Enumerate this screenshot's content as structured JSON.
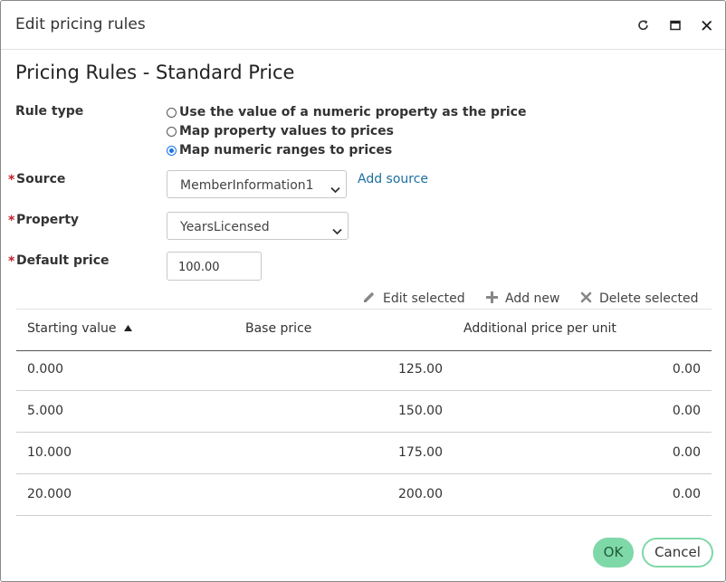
{
  "dialog": {
    "title": "Edit pricing rules",
    "heading": "Pricing Rules - Standard Price",
    "controls": {
      "refresh_icon": "refresh-icon",
      "maximize_icon": "maximize-icon",
      "close_icon": "close-icon"
    }
  },
  "form": {
    "required_marker": "*",
    "rule_type": {
      "label": "Rule type",
      "options": [
        {
          "label": "Use the value of a numeric property as the price",
          "checked": false
        },
        {
          "label": "Map property values to prices",
          "checked": false
        },
        {
          "label": "Map numeric ranges to prices",
          "checked": true
        }
      ]
    },
    "source": {
      "label": "Source",
      "value": "MemberInformation1",
      "add_link": "Add source"
    },
    "property": {
      "label": "Property",
      "value": "YearsLicensed"
    },
    "default_price": {
      "label": "Default price",
      "value": "100.00"
    }
  },
  "toolbar": {
    "edit_label": "Edit selected",
    "add_label": "Add new",
    "delete_label": "Delete selected",
    "edit_icon": "pencil-icon",
    "add_icon": "plus-icon",
    "delete_icon": "x-icon"
  },
  "table": {
    "columns": [
      "Starting value",
      "Base price",
      "Additional price per unit"
    ],
    "sort": {
      "column": "Starting value",
      "direction": "ascending"
    },
    "rows": [
      [
        "0.000",
        "125.00",
        "0.00"
      ],
      [
        "5.000",
        "150.00",
        "0.00"
      ],
      [
        "10.000",
        "175.00",
        "0.00"
      ],
      [
        "20.000",
        "200.00",
        "0.00"
      ]
    ]
  },
  "buttons": {
    "ok": "OK",
    "cancel": "Cancel"
  },
  "colors": {
    "accent": "#7fd8a8",
    "link": "#1d6f9f",
    "required": "#c0202a",
    "radio": "#1a73e8"
  }
}
